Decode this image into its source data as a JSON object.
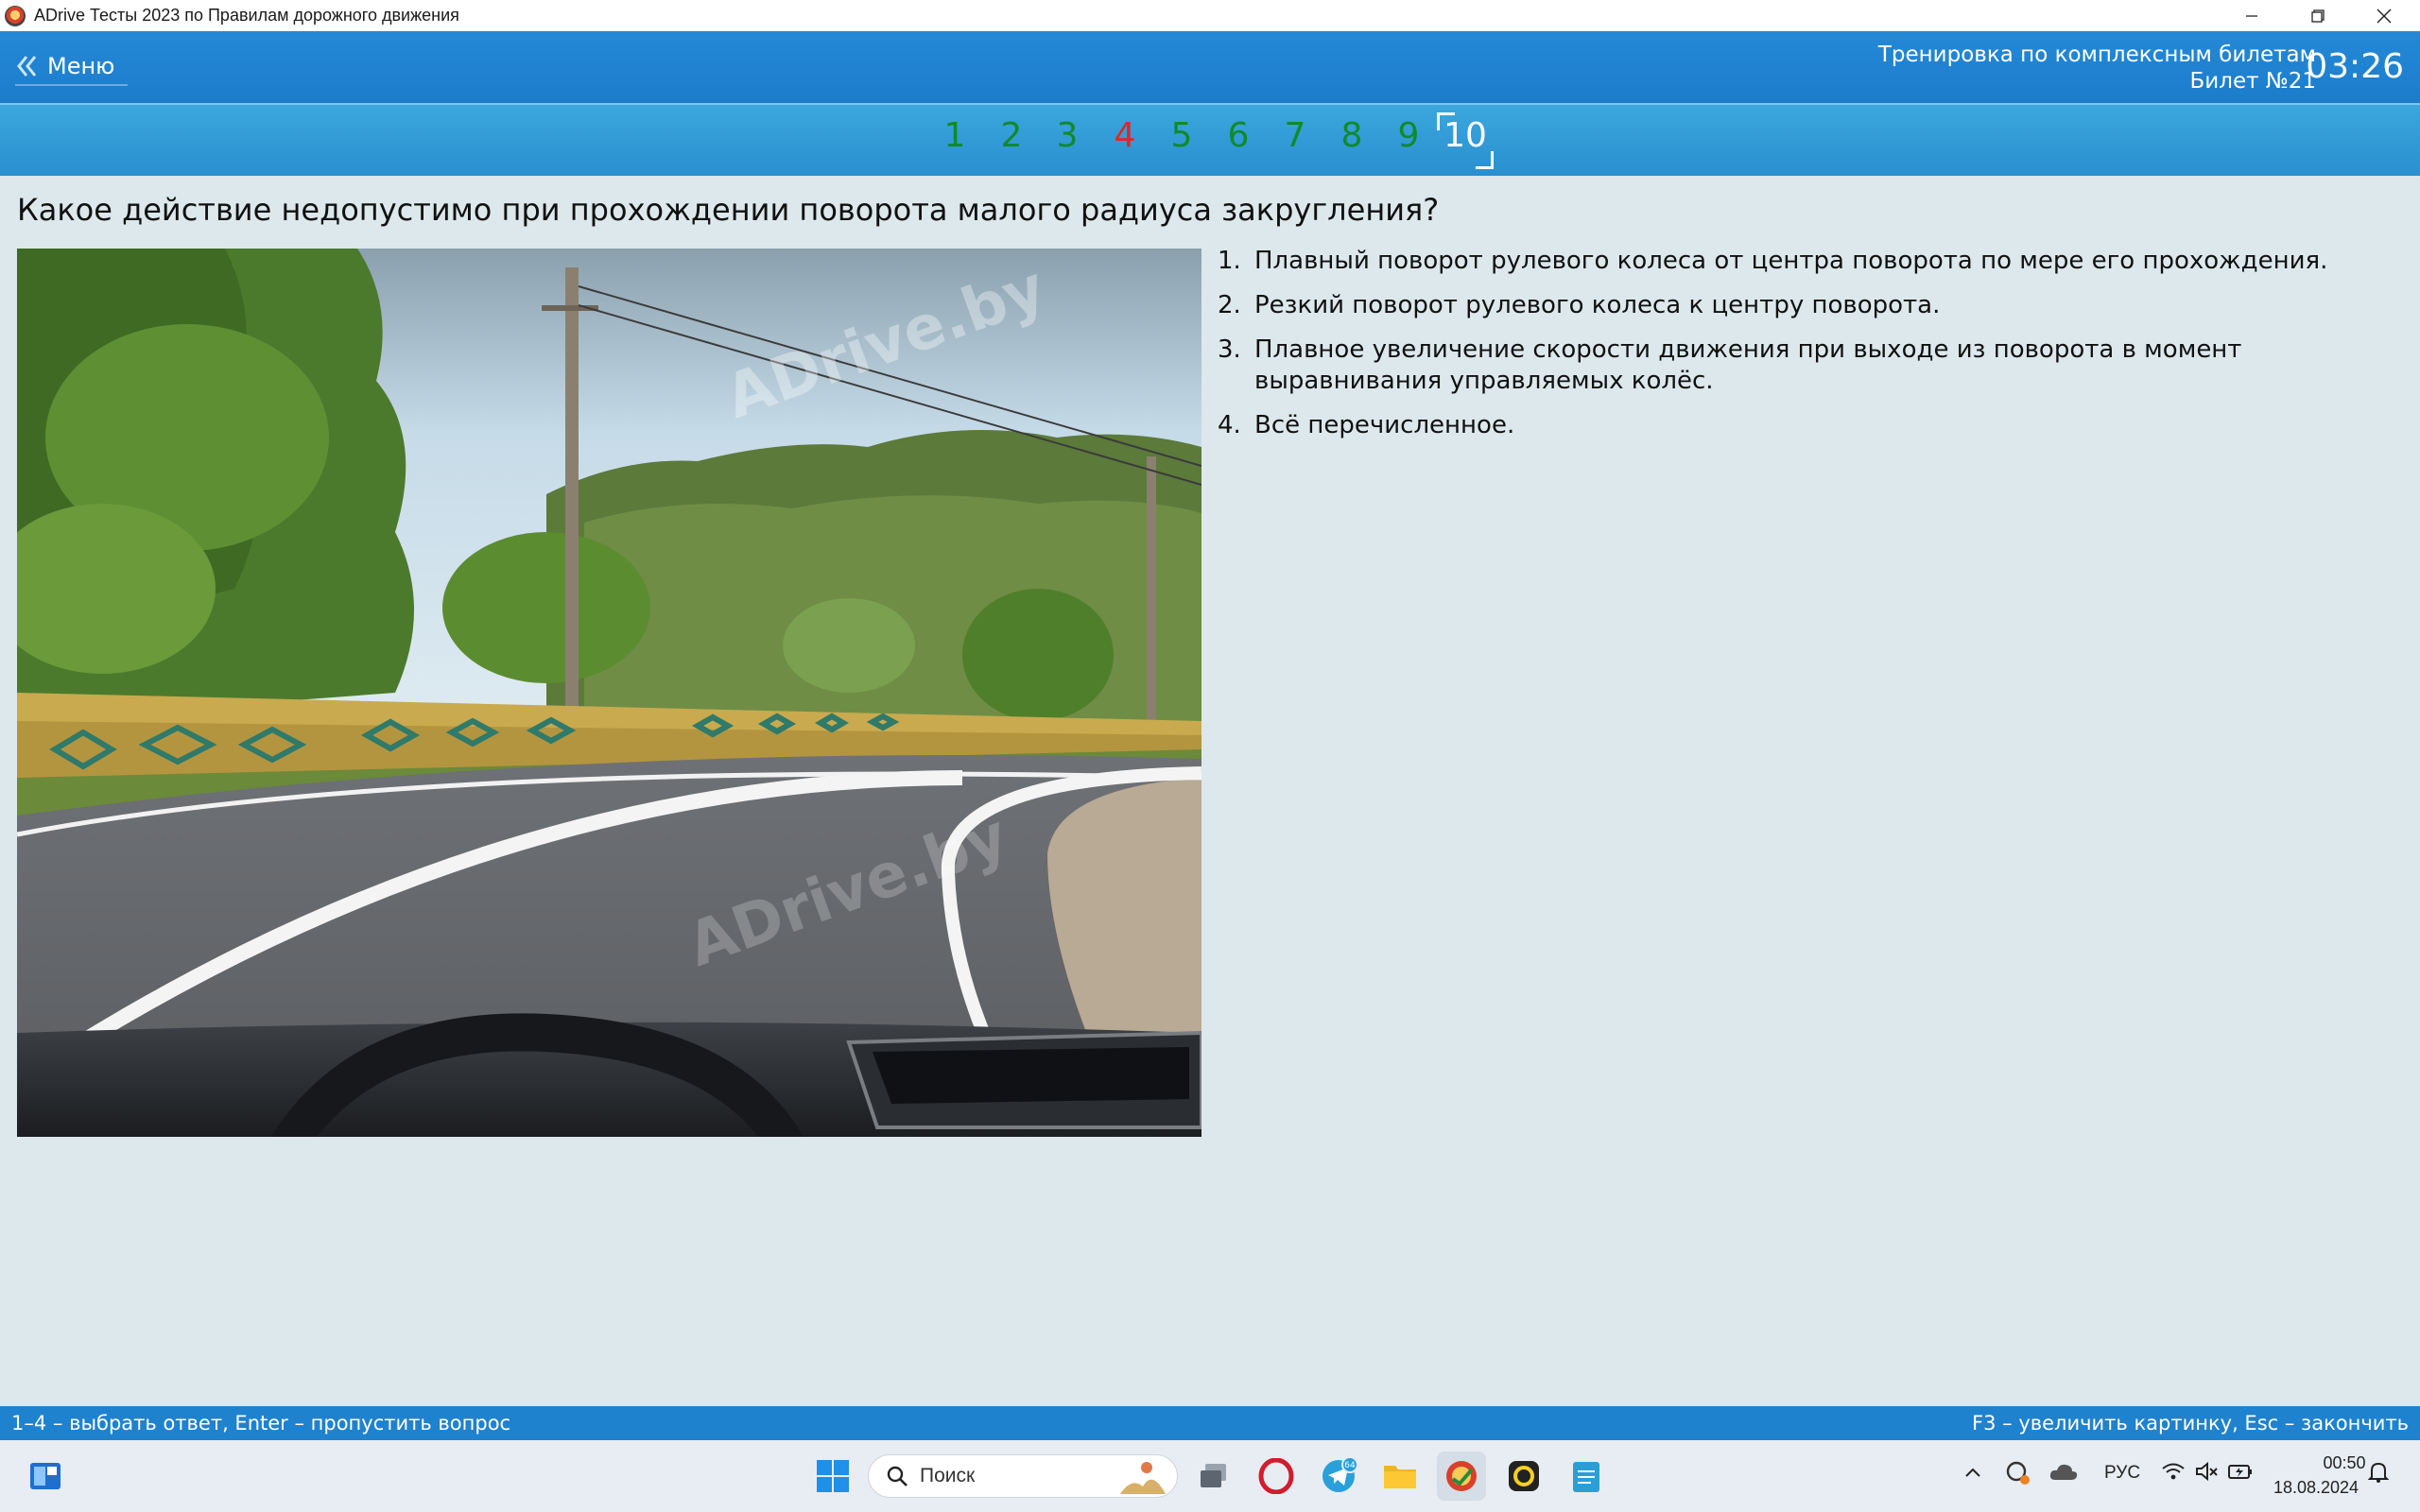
{
  "window": {
    "title": "ADrive Тесты 2023 по Правилам дорожного движения",
    "min_icon": "minimize-icon",
    "max_icon": "restore-icon",
    "close_icon": "close-icon"
  },
  "header": {
    "menu_label": "Меню",
    "mode_title": "Тренировка по комплексным билетам",
    "ticket": "Билет №21",
    "timer": "03:26"
  },
  "nav": {
    "questions": [
      {
        "label": "1",
        "status": "correct"
      },
      {
        "label": "2",
        "status": "correct"
      },
      {
        "label": "3",
        "status": "correct"
      },
      {
        "label": "4",
        "status": "wrong"
      },
      {
        "label": "5",
        "status": "correct"
      },
      {
        "label": "6",
        "status": "correct"
      },
      {
        "label": "7",
        "status": "correct"
      },
      {
        "label": "8",
        "status": "correct"
      },
      {
        "label": "9",
        "status": "correct"
      },
      {
        "label": "10",
        "status": "current"
      }
    ]
  },
  "question": {
    "text": "Какое действие недопустимо при прохождении поворота малого радиуса закругления?",
    "image_watermark": "ADrive.by"
  },
  "answers": [
    {
      "num": "1.",
      "text": "Плавный поворот рулевого колеса от центра поворота по мере его прохождения."
    },
    {
      "num": "2.",
      "text": "Резкий поворот рулевого колеса к центру поворота."
    },
    {
      "num": "3.",
      "text": "Плавное увеличение скорости движения при выходе из поворота в момент выравнивания управляемых колёс."
    },
    {
      "num": "4.",
      "text": "Всё перечисленное."
    }
  ],
  "hints": {
    "left": "1–4 – выбрать ответ, Enter – пропустить вопрос",
    "right": "F3 – увеличить картинку, Esc – закончить"
  },
  "taskbar": {
    "search_placeholder": "Поиск",
    "telegram_badge": "64",
    "language": "РУС",
    "time": "00:50",
    "date": "18.08.2024"
  },
  "colors": {
    "correct": "#0f8a2c",
    "wrong": "#e0252b",
    "current": "#ffffff",
    "header": "#1e82cf"
  }
}
